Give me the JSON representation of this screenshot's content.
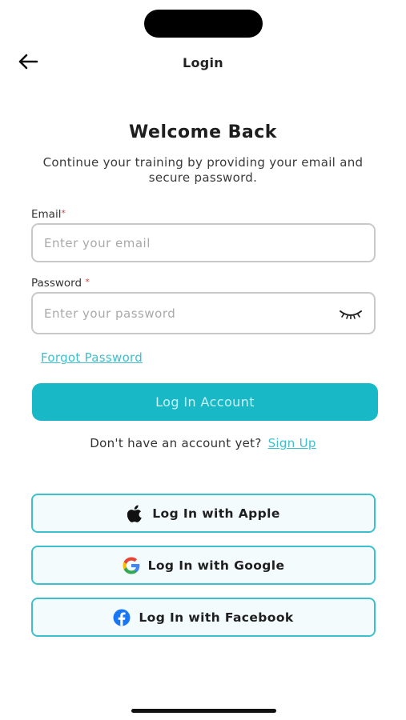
{
  "header": {
    "title": "Login"
  },
  "intro": {
    "title": "Welcome Back",
    "subtitle": "Continue your training by providing your email and secure password."
  },
  "form": {
    "email_label": "Email",
    "email_placeholder": "Enter your email",
    "password_label": "Password",
    "password_placeholder": "Enter your password",
    "required_mark": "*",
    "forgot_label": "Forgot Password",
    "login_label": "Log In Account"
  },
  "signup": {
    "prompt": "Don't have an account yet?",
    "link": "Sign Up"
  },
  "social": {
    "apple_label": "Log In with Apple",
    "google_label": "Log In with Google",
    "facebook_label": "Log In with Facebook"
  },
  "colors": {
    "accent": "#18b8c7",
    "link": "#3fbfce",
    "required": "#e53935"
  }
}
